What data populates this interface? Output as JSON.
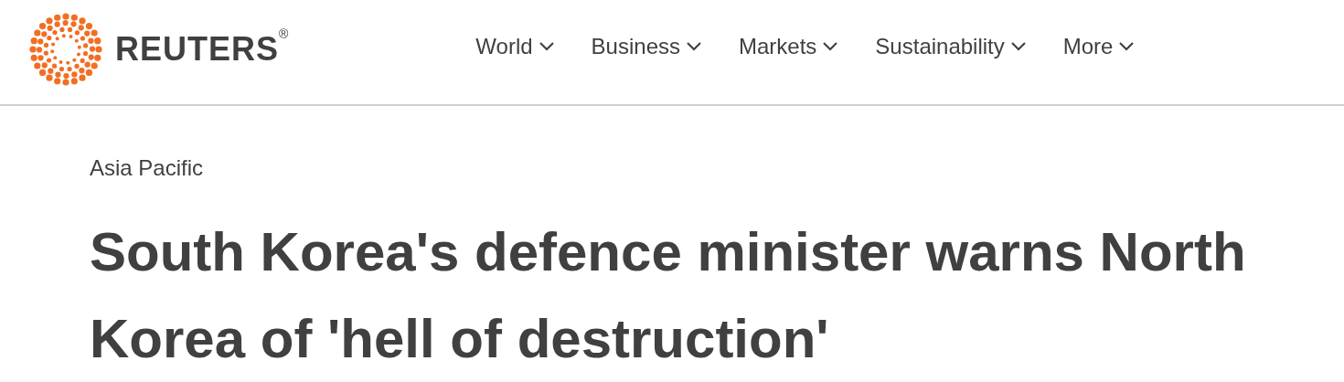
{
  "header": {
    "logo": {
      "wordmark": "REUTERS",
      "mark": "®"
    },
    "nav": [
      {
        "label": "World",
        "expanded": false
      },
      {
        "label": "Business",
        "expanded": false
      },
      {
        "label": "Markets",
        "expanded": false
      },
      {
        "label": "Sustainability",
        "expanded": false
      },
      {
        "label": "More",
        "expanded": false
      }
    ]
  },
  "article": {
    "section": "Asia Pacific",
    "headline": "South Korea's defence minister warns North Korea of 'hell of destruction'"
  }
}
